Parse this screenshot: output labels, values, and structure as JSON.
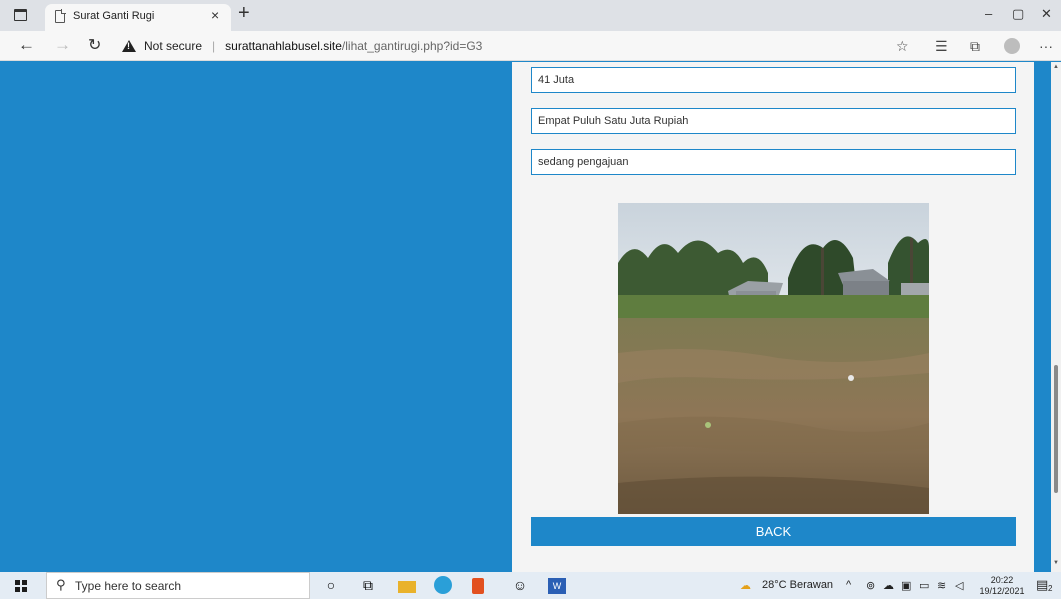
{
  "browser": {
    "tab_title": "Surat Ganti Rugi",
    "tab_close": "×",
    "new_tab": "+",
    "window_buttons": {
      "minimize": "–",
      "restore": "▢",
      "close": "✕"
    },
    "security_label": "Not secure",
    "url_host": "surattanahlabusel.site",
    "url_path": "/lihat_gantirugi.php?id=G3"
  },
  "form": {
    "fields": [
      {
        "value": "41 Juta"
      },
      {
        "value": "Empat Puluh Satu Juta Rupiah"
      },
      {
        "value": "sedang pengajuan"
      }
    ],
    "back_label": "BACK"
  },
  "colors": {
    "page_bg": "#1e87c9",
    "panel_bg": "#f4f4f4",
    "button_bg": "#1e87c9"
  },
  "taskbar": {
    "search_placeholder": "Type here to search",
    "weather": "28°C  Berawan",
    "time": "20:22",
    "date": "19/12/2021",
    "notification_count": "2"
  }
}
